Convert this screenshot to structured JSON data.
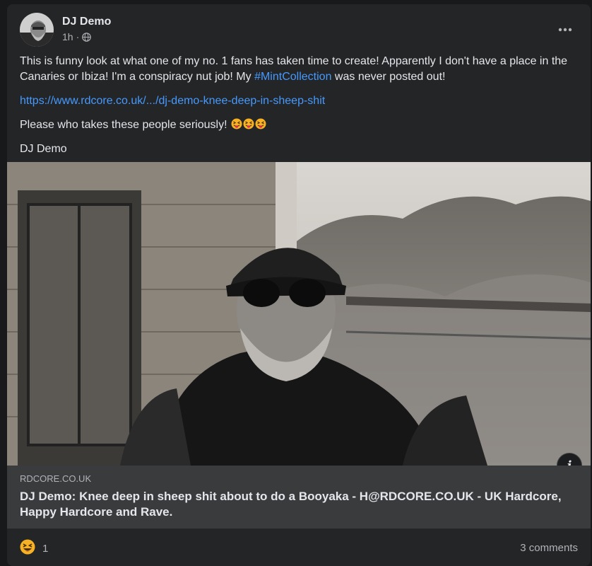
{
  "post": {
    "author": "DJ Demo",
    "time": "1h",
    "more_icon": "more-horizontal-icon",
    "privacy_icon": "globe-icon",
    "text_line1_before_tag": "This is funny look at what one of my no. 1 fans has taken time to create! Apparently I don't have a place in the Canaries or Ibiza! I'm a conspiracy nut job! My ",
    "hashtag": "#MintCollection",
    "text_line1_after_tag": " was never posted out!",
    "url": "https://www.rdcore.co.uk/.../dj-demo-knee-deep-in-sheep-shit",
    "text_line3": "Please who takes these people seriously!",
    "signature": "DJ Demo"
  },
  "link_card": {
    "domain": "RDCORE.CO.UK",
    "title": "DJ Demo: Knee deep in sheep shit about to do a Booyaka - H@RDCORE.CO.UK - UK Hardcore, Happy Hardcore and Rave."
  },
  "footer": {
    "reaction_count": "1",
    "comments": "3 comments"
  },
  "colors": {
    "background": "#18191a",
    "card": "#242526",
    "link": "#4599ff",
    "emoji": "#f7b125"
  }
}
